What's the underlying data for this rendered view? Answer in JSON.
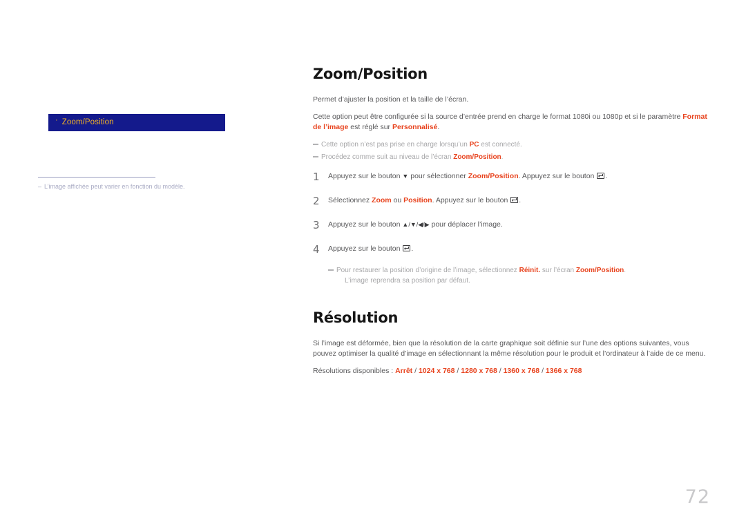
{
  "colors": {
    "accent": "#e8441f",
    "sidebar_bg": "#141a8c",
    "sidebar_text": "#f5b324",
    "body_text": "#58585a",
    "note_text": "#a7a7a9",
    "heading": "#161616",
    "page_number": "#c9c9cb"
  },
  "sidebar": {
    "items": [
      {
        "bullet": "·",
        "label": "Zoom/Position"
      }
    ],
    "note": {
      "dash": "–",
      "text": "L’image affichée peut varier en fonction du modèle."
    }
  },
  "main": {
    "section1": {
      "title": "Zoom/Position",
      "intro": "Permet d’ajuster la position et la taille de l’écran.",
      "paragraph2": {
        "part1": "Cette option peut être configurée si la source d’entrée prend en charge le format 1080i ou 1080p et si le paramètre ",
        "hl1": "Format de l’image",
        "part2": " est réglé sur ",
        "hl2": "Personnalisé",
        "part3": "."
      },
      "notes": [
        {
          "part1": "Cette option n’est pas prise en charge lorsqu’un ",
          "hl1": "PC",
          "part2": " est connecté."
        },
        {
          "part1": "Procédez comme suit au niveau de l’écran ",
          "hl1": "Zoom/Position",
          "part2": "."
        }
      ],
      "steps": [
        {
          "num": "1",
          "part1": "Appuyez sur le bouton ",
          "glyph1": "▼",
          "part2": " pour sélectionner ",
          "hl1": "Zoom/Position",
          "part3": ". Appuyez sur le bouton ",
          "icon": "enter-icon",
          "part4": "."
        },
        {
          "num": "2",
          "part1": "Sélectionnez ",
          "hl1": "Zoom",
          "part2": " ou ",
          "hl2": "Position",
          "part3": ". Appuyez sur le bouton ",
          "icon": "enter-icon",
          "part4": "."
        },
        {
          "num": "3",
          "part1": "Appuyez sur le bouton ",
          "glyph1": "▲/▼/◀/▶",
          "part2": " pour déplacer l’image."
        },
        {
          "num": "4",
          "part1": "Appuyez sur le bouton ",
          "icon": "enter-icon",
          "part2": "."
        }
      ],
      "final_note": {
        "part1": "Pour restaurer la position d’origine de l’image, sélectionnez ",
        "hl1": "Réinit.",
        "part2": " sur l’écran ",
        "hl2": "Zoom/Position",
        "part3": ".",
        "line2": "L’image reprendra sa position par défaut."
      }
    },
    "section2": {
      "title": "Résolution",
      "paragraph": "Si l’image est déformée, bien que la résolution de la carte graphique soit définie sur l’une des options suivantes, vous pouvez optimiser la qualité d’image en sélectionnant la même résolution pour le produit et l’ordinateur à l’aide de ce menu.",
      "available_label": "Résolutions disponibles : ",
      "options": [
        "Arrêt",
        "1024 x 768",
        "1280 x 768",
        "1360 x 768",
        "1366 x 768"
      ],
      "separator": " / "
    }
  },
  "footer": {
    "page_number": "72"
  }
}
